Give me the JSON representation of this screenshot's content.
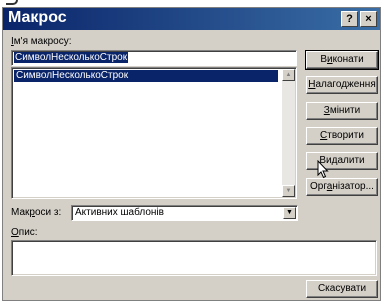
{
  "window": {
    "title": "Макрос"
  },
  "titlebar_buttons": {
    "help": "?",
    "close": "×"
  },
  "name": {
    "label_prefix": "І",
    "label_rest": "м'я макросу:",
    "value": "СимволНесколькоСтрок"
  },
  "macro_list": {
    "items": [
      "СимволНесколькоСтрок"
    ],
    "selected_index": 0
  },
  "buttons": {
    "run_pre": "В",
    "run_u": "и",
    "run_post": "конати",
    "step_u": "Н",
    "step_post": "алагодження",
    "edit_u": "З",
    "edit_post": "мінити",
    "create_u": "С",
    "create_post": "творити",
    "delete_pre": "Ви",
    "delete_u": "д",
    "delete_post": "алити",
    "organizer_pre": "Орг",
    "organizer_u": "а",
    "organizer_post": "нізатор...",
    "cancel": "Скасувати"
  },
  "macros_in": {
    "label_pre": "Мак",
    "label_u": "р",
    "label_post": "оси з:",
    "value": "Активних шаблонів"
  },
  "description": {
    "label_u": "О",
    "label_post": "пис:",
    "value": ""
  },
  "colors": {
    "dialog_face": "#d4d0c8",
    "title_start": "#0a246a",
    "title_end": "#3a6ea5",
    "selection": "#0a246a"
  },
  "icons": {
    "cursor": "mouse-pointer-icon",
    "scroll_up": "triangle-up-icon",
    "scroll_down": "triangle-down-icon",
    "combo": "triangle-down-icon"
  }
}
